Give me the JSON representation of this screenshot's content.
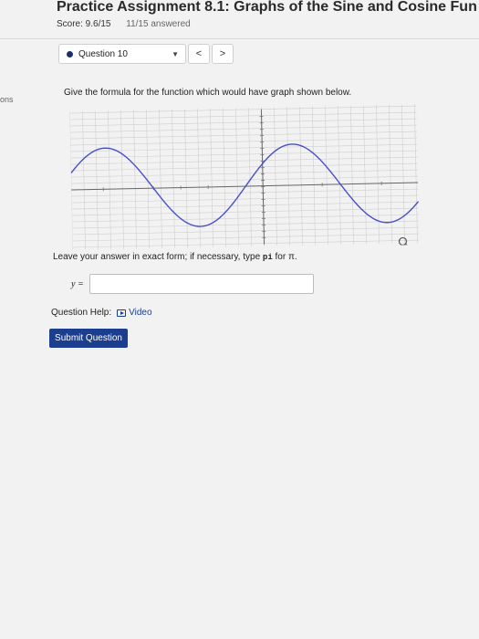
{
  "header": {
    "title": "Practice Assignment 8.1: Graphs of the Sine and Cosine Fun",
    "score": "Score: 9.6/15",
    "answered": "11/15 answered"
  },
  "nav": {
    "question_label": "Question 10",
    "prev_symbol": "<",
    "next_symbol": ">"
  },
  "sidebar": {
    "partial_text": "ons"
  },
  "question": {
    "prompt": "Give the formula for the function which would have graph shown below.",
    "instruction_before": "Leave your answer in exact form; if necessary, type ",
    "instruction_code": "pi",
    "instruction_after": " for π.",
    "answer_label": "y =",
    "answer_value": ""
  },
  "help": {
    "label": "Question Help:",
    "video_label": "Video"
  },
  "submit_label": "Submit Question",
  "colors": {
    "curve": "#4a4fc9",
    "submit_bg": "#1b3f8e",
    "grid": "#cfcfcf"
  },
  "chart_data": {
    "type": "line",
    "title": "",
    "xlabel": "",
    "ylabel": "",
    "grid": true,
    "function_shape": "sinusoid",
    "extrema_relative_to_axis": [
      {
        "kind": "max",
        "x_frac": 0.1
      },
      {
        "kind": "min",
        "x_frac": 0.37
      },
      {
        "kind": "max",
        "x_frac": 0.64
      },
      {
        "kind": "min",
        "x_frac": 0.91
      }
    ]
  }
}
